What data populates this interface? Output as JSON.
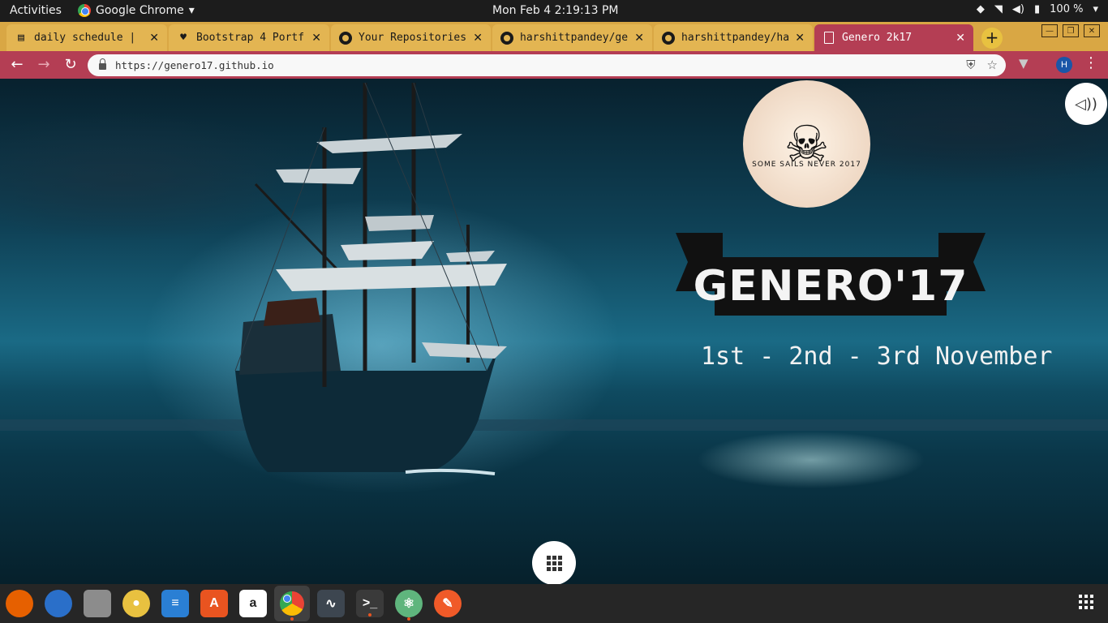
{
  "system": {
    "activities": "Activities",
    "app_name": "Google Chrome",
    "clock": "Mon Feb 4   2:19:13 PM",
    "battery": "100 %"
  },
  "tabs": [
    {
      "label": "daily schedule  |",
      "icon": "notebook-icon"
    },
    {
      "label": "Bootstrap 4 Portf",
      "icon": "heart-icon"
    },
    {
      "label": "Your Repositories",
      "icon": "github-icon"
    },
    {
      "label": "harshittpandey/ge",
      "icon": "github-icon"
    },
    {
      "label": "harshittpandey/ha",
      "icon": "github-icon"
    },
    {
      "label": "Genero 2k17",
      "icon": "document-icon"
    }
  ],
  "toolbar": {
    "url": "https://genero17.github.io",
    "profile_initial": "H"
  },
  "page": {
    "logo_motto": "SOME SAILS NEVER 2017",
    "title": "GENERO'17",
    "dates": "1st - 2nd - 3rd November"
  },
  "dock": [
    {
      "name": "firefox",
      "color": "#e66000"
    },
    {
      "name": "thunderbird",
      "color": "#2a6fc9"
    },
    {
      "name": "files",
      "color": "#8c8c8c"
    },
    {
      "name": "rhythmbox",
      "color": "#e8c140"
    },
    {
      "name": "libreoffice-writer",
      "color": "#2a7fd4"
    },
    {
      "name": "ubuntu-software",
      "color": "#e95420"
    },
    {
      "name": "amazon",
      "color": "#ffffff"
    },
    {
      "name": "chrome",
      "color": "#4285f4"
    },
    {
      "name": "system-monitor",
      "color": "#3d4650"
    },
    {
      "name": "terminal",
      "color": "#3a3a3a"
    },
    {
      "name": "atom",
      "color": "#5fb57d"
    },
    {
      "name": "brave-pen",
      "color": "#f05a28"
    }
  ]
}
